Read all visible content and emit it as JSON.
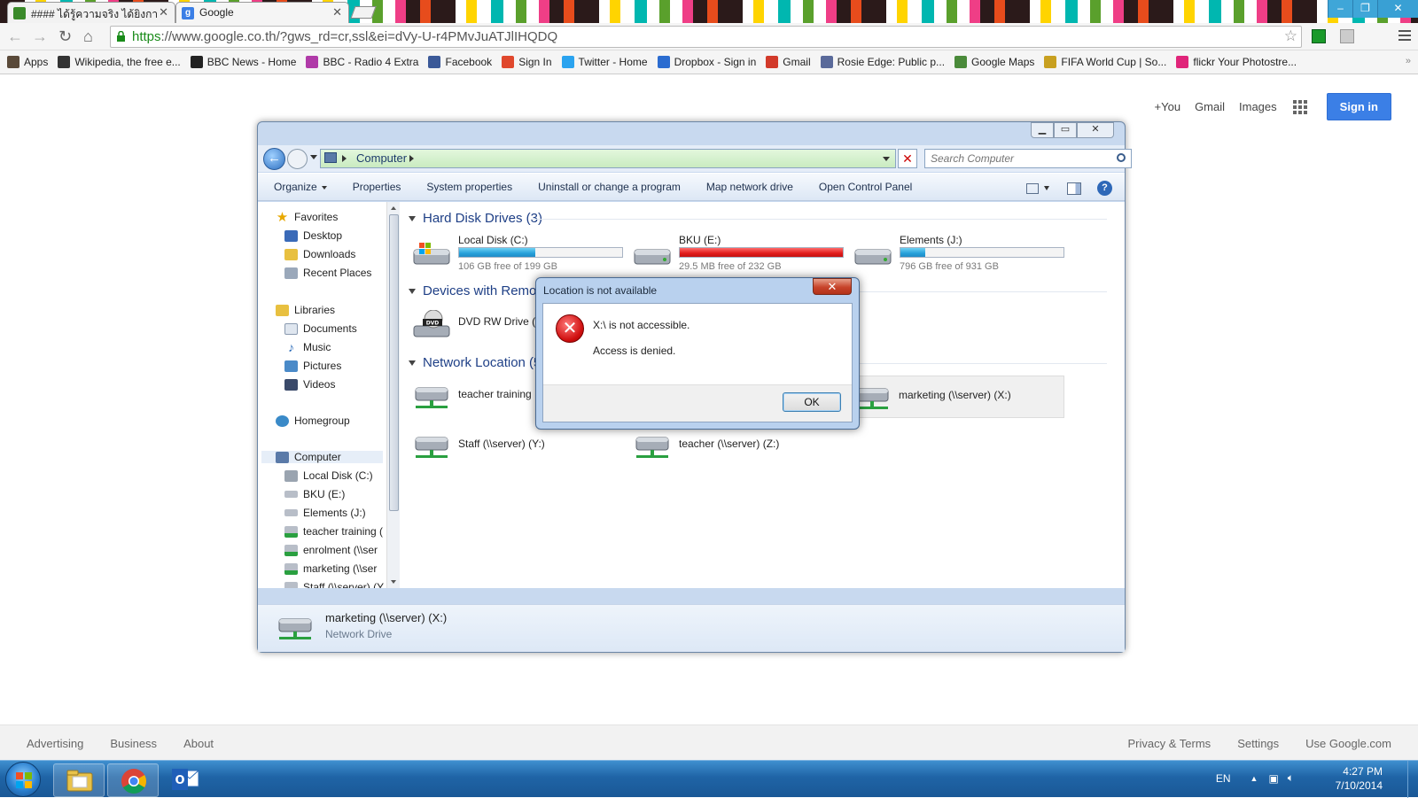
{
  "browser": {
    "tabs": [
      {
        "title": "#### ได้รู้ความจริง ได้ยิงกา",
        "favicon": "green-tab-favicon",
        "active": false
      },
      {
        "title": "Google",
        "favicon": "google-g-favicon",
        "active": true
      }
    ],
    "url_scheme": "https",
    "url_rest": "://www.google.co.th/?gws_rd=cr,ssl&ei=dVy-U-r4PMvJuATJlIHQDQ",
    "bookmarks": [
      {
        "label": "Apps",
        "icon": "apps-icon",
        "color": "#5a4a3a"
      },
      {
        "label": "Wikipedia, the free e...",
        "icon": "wikipedia-icon",
        "color": "#333333"
      },
      {
        "label": "BBC News - Home",
        "icon": "bbc-icon",
        "color": "#222222"
      },
      {
        "label": "BBC - Radio 4 Extra",
        "icon": "radio-icon",
        "color": "#b03aa8"
      },
      {
        "label": "Facebook",
        "icon": "facebook-icon",
        "color": "#3b5998"
      },
      {
        "label": "Sign In",
        "icon": "microsoft-icon",
        "color": "#e0482d"
      },
      {
        "label": "Twitter - Home",
        "icon": "twitter-icon",
        "color": "#2aa3ef"
      },
      {
        "label": "Dropbox - Sign in",
        "icon": "dropbox-icon",
        "color": "#2b6cd0"
      },
      {
        "label": "Gmail",
        "icon": "gmail-icon",
        "color": "#d23a2a"
      },
      {
        "label": "Rosie Edge: Public p...",
        "icon": "grid-icon",
        "color": "#5a6a9a"
      },
      {
        "label": "Google Maps",
        "icon": "maps-icon",
        "color": "#4a8a3a"
      },
      {
        "label": "FIFA World Cup | So...",
        "icon": "fifa-icon",
        "color": "#c8a020"
      },
      {
        "label": "flickr Your Photostre...",
        "icon": "flickr-icon",
        "color": "#e0257a"
      }
    ]
  },
  "google": {
    "top_links": [
      "+You",
      "Gmail",
      "Images"
    ],
    "signin_label": "Sign in",
    "footer_left": [
      "Advertising",
      "Business",
      "About"
    ],
    "footer_right": [
      "Privacy & Terms",
      "Settings",
      "Use Google.com"
    ]
  },
  "explorer": {
    "address": "Computer",
    "search_placeholder": "Search Computer",
    "commands": [
      "Organize",
      "Properties",
      "System properties",
      "Uninstall or change a program",
      "Map network drive",
      "Open Control Panel"
    ],
    "nav": {
      "favorites": "Favorites",
      "favorite_items": [
        "Desktop",
        "Downloads",
        "Recent Places"
      ],
      "libraries": "Libraries",
      "library_items": [
        "Documents",
        "Music",
        "Pictures",
        "Videos"
      ],
      "homegroup": "Homegroup",
      "computer": "Computer",
      "computer_items": [
        "Local Disk (C:)",
        "BKU (E:)",
        "Elements (J:)",
        "teacher training (",
        "enrolment (\\\\ser",
        "marketing (\\\\ser",
        "Staff (\\\\server) (Y"
      ]
    },
    "groups": {
      "hard_disks": "Hard Disk Drives (3)",
      "removable": "Devices with Remov",
      "network": "Network Location (5"
    },
    "drives": [
      {
        "name": "Local Disk (C:)",
        "free": "106 GB free of 199 GB",
        "used_fraction": 0.47,
        "bar_color": "#26a0da"
      },
      {
        "name": "BKU (E:)",
        "free": "29.5 MB free of 232 GB",
        "used_fraction": 1.0,
        "bar_color": "#e11c1c"
      },
      {
        "name": "Elements (J:)",
        "free": "796 GB free of 931 GB",
        "used_fraction": 0.15,
        "bar_color": "#26a0da"
      }
    ],
    "removable": [
      {
        "name": "DVD RW Drive ("
      }
    ],
    "network": [
      {
        "name": "teacher training"
      },
      {
        "name": "marketing (\\\\server) (X:)"
      },
      {
        "name": "Staff (\\\\server) (Y:)"
      },
      {
        "name": "teacher (\\\\server) (Z:)"
      }
    ],
    "status": {
      "name": "marketing (\\\\server) (X:)",
      "type": "Network Drive"
    }
  },
  "dialog": {
    "title": "Location is not available",
    "message": "X:\\ is not accessible.",
    "detail": "Access is denied.",
    "ok_label": "OK"
  },
  "taskbar": {
    "lang": "EN",
    "time": "4:27 PM",
    "date": "7/10/2014"
  }
}
